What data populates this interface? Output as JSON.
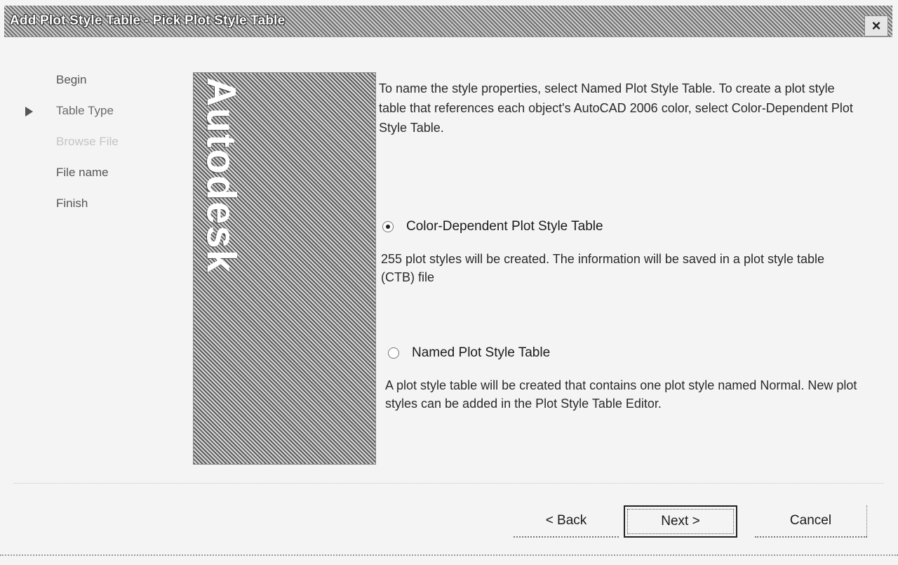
{
  "window": {
    "title": "Add Plot Style Table - Pick Plot Style Table",
    "close_label": "×"
  },
  "steps": [
    {
      "label": "Begin",
      "state": "done"
    },
    {
      "label": "Table Type",
      "state": "current"
    },
    {
      "label": "Browse File",
      "state": "disabled"
    },
    {
      "label": "File name",
      "state": "pending"
    },
    {
      "label": "Finish",
      "state": "pending"
    }
  ],
  "banner": {
    "logo_text": "Autodesk"
  },
  "intro": "To name the style properties, select Named Plot Style Table. To create a plot style table that references each object's AutoCAD 2006 color, select Color-Dependent Plot Style Table.",
  "options": [
    {
      "label": "Color-Dependent Plot Style Table",
      "checked": true,
      "description": "255 plot styles will be created. The information will be saved in a plot style table (CTB) file"
    },
    {
      "label": "Named Plot Style Table",
      "checked": false,
      "description": "A plot style table will be created that contains one plot style named Normal.  New plot styles can be added in the Plot Style Table Editor."
    }
  ],
  "buttons": {
    "back": "< Back",
    "next": "Next >",
    "cancel": "Cancel"
  }
}
